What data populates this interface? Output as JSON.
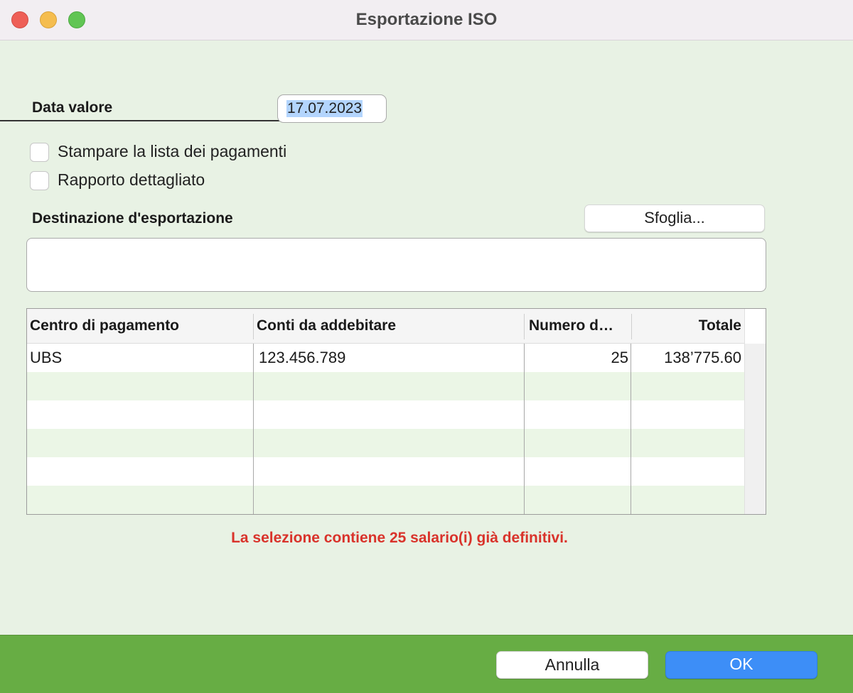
{
  "window": {
    "title": "Esportazione ISO"
  },
  "form": {
    "date_label": "Data valore",
    "date_value": "17.07.2023",
    "print_list_label": "Stampare la lista dei pagamenti",
    "print_list_checked": false,
    "detailed_report_label": "Rapporto dettagliato",
    "detailed_report_checked": false,
    "destination_label": "Destinazione d'esportazione",
    "destination_value": "",
    "browse_label": "Sfoglia..."
  },
  "table": {
    "columns": [
      "Centro di pagamento",
      "Conti da addebitare",
      "Numero d…",
      "Totale"
    ],
    "rows": [
      [
        "UBS",
        "123.456.789",
        "25",
        "138’775.60"
      ]
    ]
  },
  "warning": "La selezione contiene 25 salario(i) già definitivi.",
  "footer": {
    "cancel_label": "Annulla",
    "ok_label": "OK"
  },
  "colors": {
    "window_bg": "#e8f2e4",
    "footer_bg": "#67ad44",
    "ok_button": "#3d8ef7",
    "warning_text": "#d9332b",
    "row_alt": "#ebf6e6"
  }
}
